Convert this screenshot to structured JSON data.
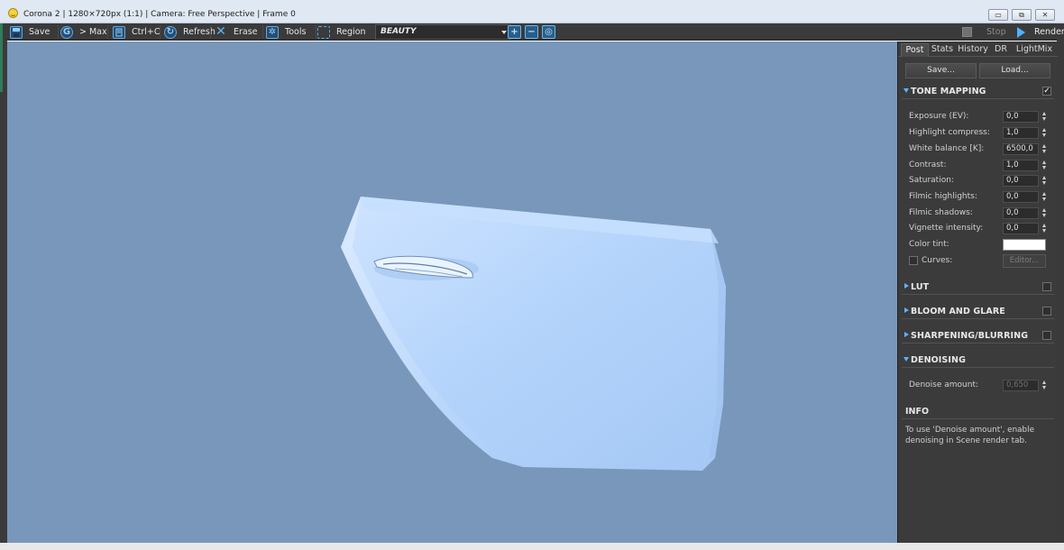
{
  "window": {
    "title": "Corona 2 | 1280×720px (1:1) | Camera: Free Perspective | Frame 0",
    "minimize_glyph": "▭",
    "maximize_glyph": "⧉",
    "close_glyph": "✕"
  },
  "toolbar": {
    "save_label": "Save",
    "max_label": "> Max",
    "copy_label": "Ctrl+C",
    "refresh_label": "Refresh",
    "erase_label": "Erase",
    "tools_label": "Tools",
    "region_label": "Region",
    "pass_value": "BEAUTY",
    "stop_label": "Stop",
    "render_label": "Render",
    "icons": [
      "save-icon",
      "max-icon",
      "copy-icon",
      "refresh-icon",
      "erase-icon",
      "gear-icon",
      "region-icon",
      "zoom-in-icon",
      "zoom-out-icon",
      "zoom-fit-icon"
    ]
  },
  "panel": {
    "tabs": [
      "Post",
      "Stats",
      "History",
      "DR",
      "LightMix"
    ],
    "active_tab": "Post",
    "save_button": "Save...",
    "load_button": "Load...",
    "tone_mapping": {
      "title": "TONE MAPPING",
      "enabled": true,
      "params": [
        {
          "label": "Exposure (EV):",
          "value": "0,0"
        },
        {
          "label": "Highlight compress:",
          "value": "1,0"
        },
        {
          "label": "White balance [K]:",
          "value": "6500,0"
        },
        {
          "label": "Contrast:",
          "value": "1,0"
        },
        {
          "label": "Saturation:",
          "value": "0,0"
        },
        {
          "label": "Filmic highlights:",
          "value": "0,0"
        },
        {
          "label": "Filmic shadows:",
          "value": "0,0"
        },
        {
          "label": "Vignette intensity:",
          "value": "0,0"
        }
      ],
      "color_tint_label": "Color tint:",
      "color_tint": "#ffffff",
      "curves_label": "Curves:",
      "editor_label": "Editor..."
    },
    "sections": [
      {
        "title": "LUT",
        "enabled": false
      },
      {
        "title": "BLOOM AND GLARE",
        "enabled": false
      },
      {
        "title": "SHARPENING/BLURRING",
        "enabled": false
      }
    ],
    "denoising": {
      "title": "DENOISING",
      "amount_label": "Denoise amount:",
      "amount_value": "0,650"
    },
    "info": {
      "title": "INFO",
      "text": "To use 'Denoise amount', enable denoising in Scene render tab."
    }
  },
  "colors": {
    "viewport_background": "#7997ba",
    "accent": "#4fb1ff",
    "panel_background": "#3b3b3b"
  }
}
